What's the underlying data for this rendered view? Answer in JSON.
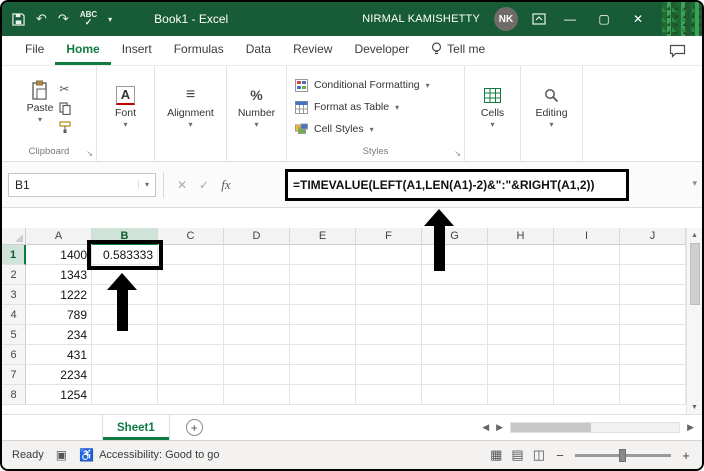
{
  "titlebar": {
    "title": "Book1 - Excel",
    "user": "NIRMAL KAMISHETTY",
    "avatar": "NK"
  },
  "ribbon": {
    "tabs": [
      {
        "label": "File"
      },
      {
        "label": "Home",
        "active": true
      },
      {
        "label": "Insert"
      },
      {
        "label": "Formulas"
      },
      {
        "label": "Data"
      },
      {
        "label": "Review"
      },
      {
        "label": "Developer"
      },
      {
        "label": "Tell me"
      }
    ],
    "groups": {
      "clipboard": {
        "paste": "Paste",
        "label": "Clipboard"
      },
      "font": {
        "label": "Font"
      },
      "alignment": {
        "label": "Alignment"
      },
      "number": {
        "label": "Number"
      },
      "styles": {
        "conditional": "Conditional Formatting",
        "format_table": "Format as Table",
        "cell_styles": "Cell Styles",
        "label": "Styles"
      },
      "cells": {
        "label": "Cells"
      },
      "editing": {
        "label": "Editing"
      }
    }
  },
  "formula_bar": {
    "name_box": "B1",
    "formula": "=TIMEVALUE(LEFT(A1,LEN(A1)-2)&\":\"&RIGHT(A1,2))"
  },
  "grid": {
    "columns": [
      "A",
      "B",
      "C",
      "D",
      "E",
      "F",
      "G",
      "H",
      "I",
      "J"
    ],
    "rows": [
      "1",
      "2",
      "3",
      "4",
      "5",
      "6",
      "7",
      "8"
    ],
    "a_values": [
      "1400",
      "1343",
      "1222",
      "789",
      "234",
      "431",
      "2234",
      "1254"
    ],
    "b1_value": "0.583333",
    "active_cell": "B1"
  },
  "sheet_bar": {
    "tab": "Sheet1"
  },
  "status_bar": {
    "ready": "Ready",
    "accessibility": "Accessibility: Good to go"
  },
  "colors": {
    "titlebar": "#185C37",
    "accent": "#107C41",
    "annotation": "#000000"
  },
  "icons": {
    "undo": "↶",
    "redo": "↷",
    "abc": "ABC",
    "check": "✓",
    "caret": "▾",
    "minimize": "—",
    "maximize": "▢",
    "close": "✕",
    "cancel": "✕",
    "fx": "fx",
    "scissors": "✂",
    "align_lines": "≡",
    "percent": "%",
    "font_letter": "A",
    "launcher": "↘",
    "plus": "+",
    "left": "◀",
    "right": "▶",
    "up": "▲",
    "down": "▼",
    "minus": "−",
    "view_normal": "▦",
    "view_layout": "▤",
    "view_break": "◫",
    "accessibility": "♿",
    "macro": "▣"
  }
}
